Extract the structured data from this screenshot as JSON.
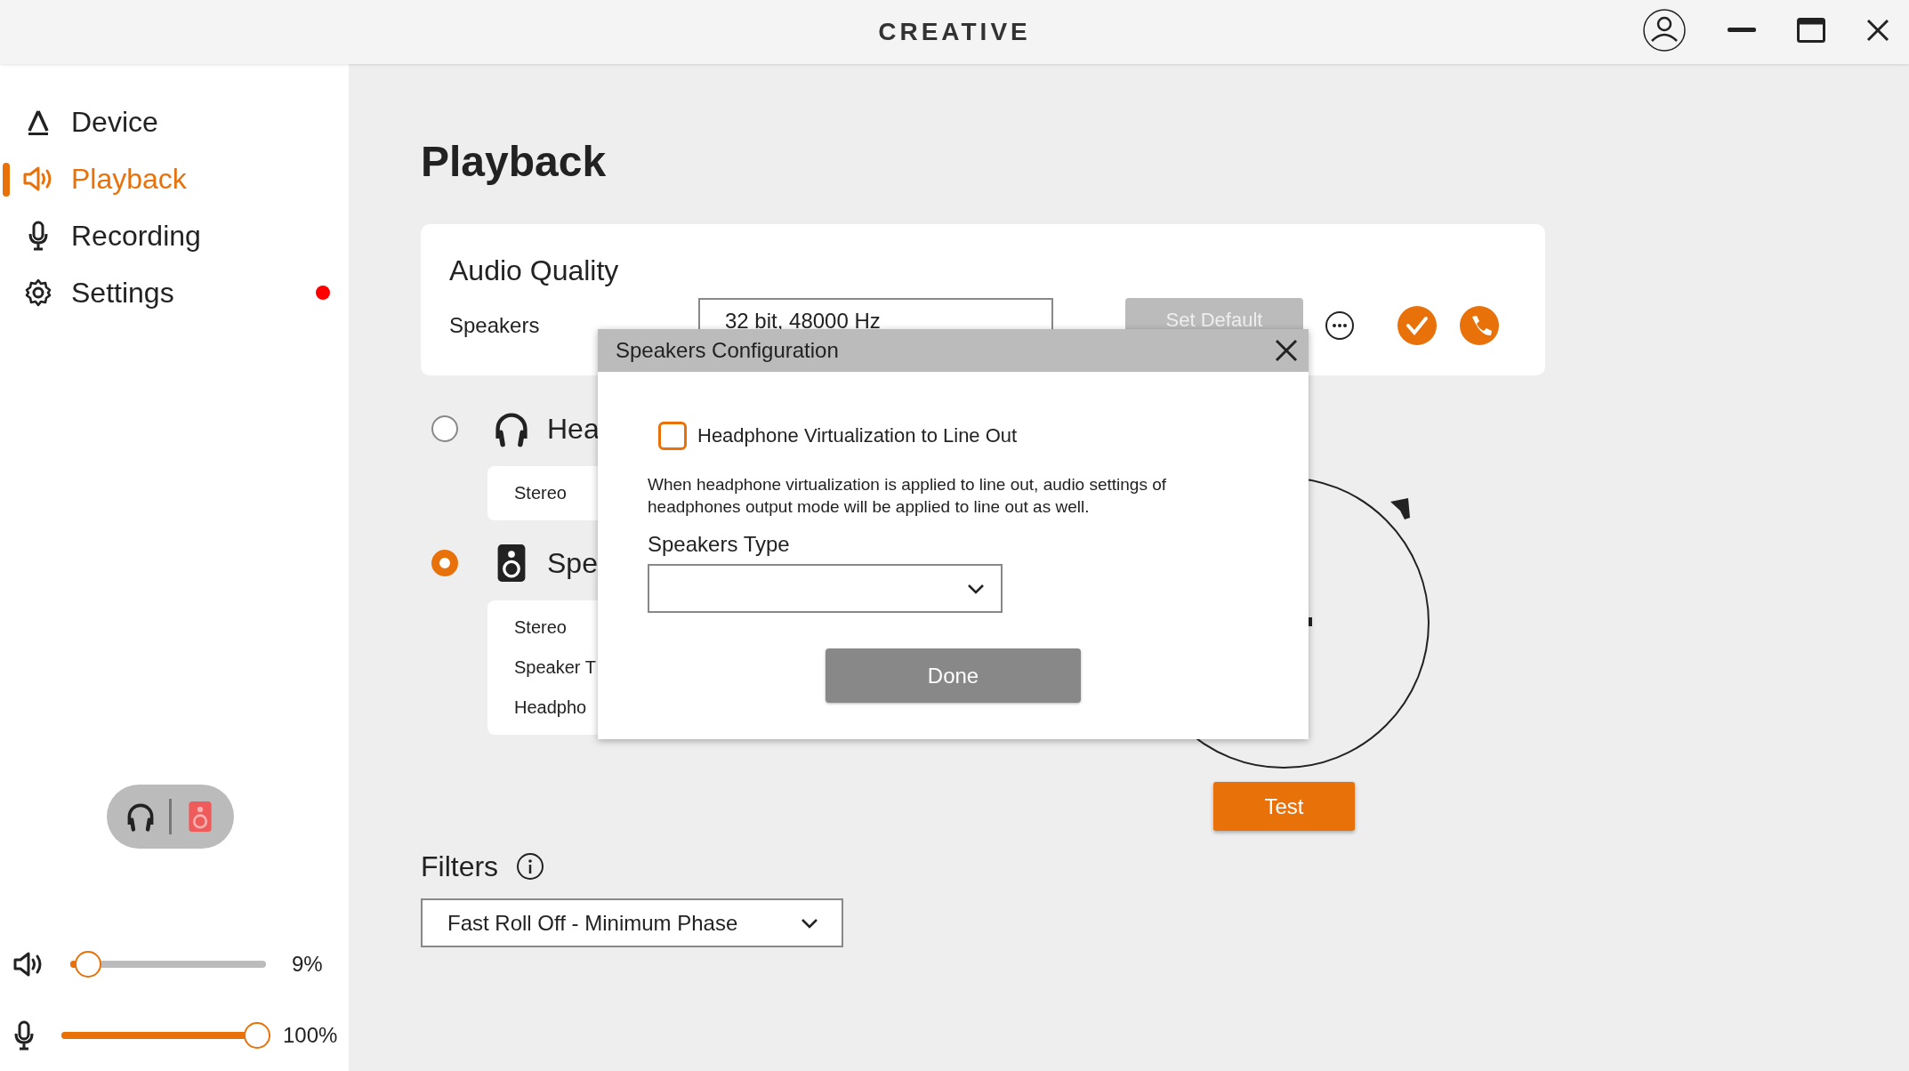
{
  "window": {
    "logo": "CREATIVE"
  },
  "sidebar": {
    "items": [
      {
        "label": "Device",
        "kind": "device",
        "selected": false,
        "notification": false
      },
      {
        "label": "Playback",
        "kind": "playback",
        "selected": true,
        "notification": false
      },
      {
        "label": "Recording",
        "kind": "recording",
        "selected": false,
        "notification": false
      },
      {
        "label": "Settings",
        "kind": "settings",
        "selected": false,
        "notification": true
      }
    ],
    "output_switch": [
      {
        "kind": "headphones",
        "selected": false
      },
      {
        "kind": "speakers",
        "selected": true
      }
    ],
    "volumes": [
      {
        "kind": "playback",
        "level": 0.09,
        "reading": "9%"
      },
      {
        "kind": "recording",
        "level": 1,
        "reading": "100%"
      }
    ]
  },
  "page_title": "Playback",
  "audio_quality": {
    "title": "Audio Quality",
    "label": "Speakers",
    "format": "32 bit, 48000 Hz",
    "set_default": "Set Default"
  },
  "outputs": [
    {
      "kind": "headphones",
      "label": "Hea",
      "selected": false,
      "modes": [
        "Stereo"
      ]
    },
    {
      "kind": "speakers",
      "label": "Spe",
      "selected": true,
      "modes": [
        "Stereo",
        "Speaker T",
        "Headpho"
      ]
    }
  ],
  "test_button": "Test",
  "filters": {
    "title": "Filters",
    "value": "Fast Roll Off - Minimum Phase"
  },
  "dialog": {
    "title": "Speakers Configuration",
    "checkbox": {
      "label": "Headphone Virtualization to Line Out",
      "checked": false
    },
    "description": "When headphone virtualization is applied to line out, audio settings of headphones output mode will be applied to line out as well.",
    "type_label": "Speakers Type",
    "done": "Done"
  }
}
